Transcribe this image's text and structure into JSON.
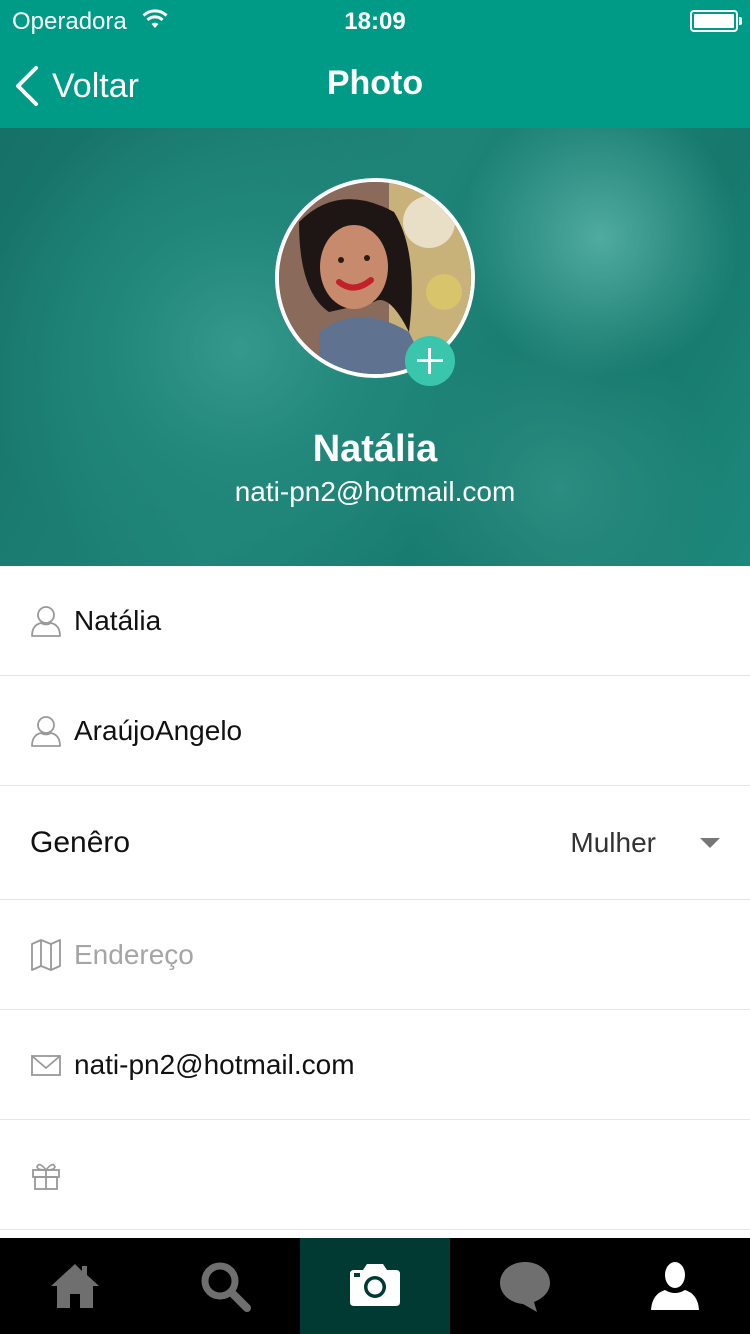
{
  "status_bar": {
    "carrier": "Operadora",
    "time": "18:09"
  },
  "nav": {
    "back_label": "Voltar",
    "title": "Photo"
  },
  "profile": {
    "name": "Natália",
    "email": "nati-pn2@hotmail.com"
  },
  "form": {
    "first_name": "Natália",
    "last_name": "AraújoAngelo",
    "gender_label": "Genêro",
    "gender_value": "Mulher",
    "address_placeholder": "Endereço",
    "email": "nati-pn2@hotmail.com",
    "birthday": ""
  },
  "tabbar": {
    "active": "camera",
    "tabs": [
      "home-icon",
      "search-icon",
      "camera-icon",
      "chat-icon",
      "profile-icon"
    ]
  },
  "colors": {
    "header": "#009b86",
    "accent": "#39c6ad",
    "tabbar": "#000000",
    "tab_active": "#003a32"
  }
}
